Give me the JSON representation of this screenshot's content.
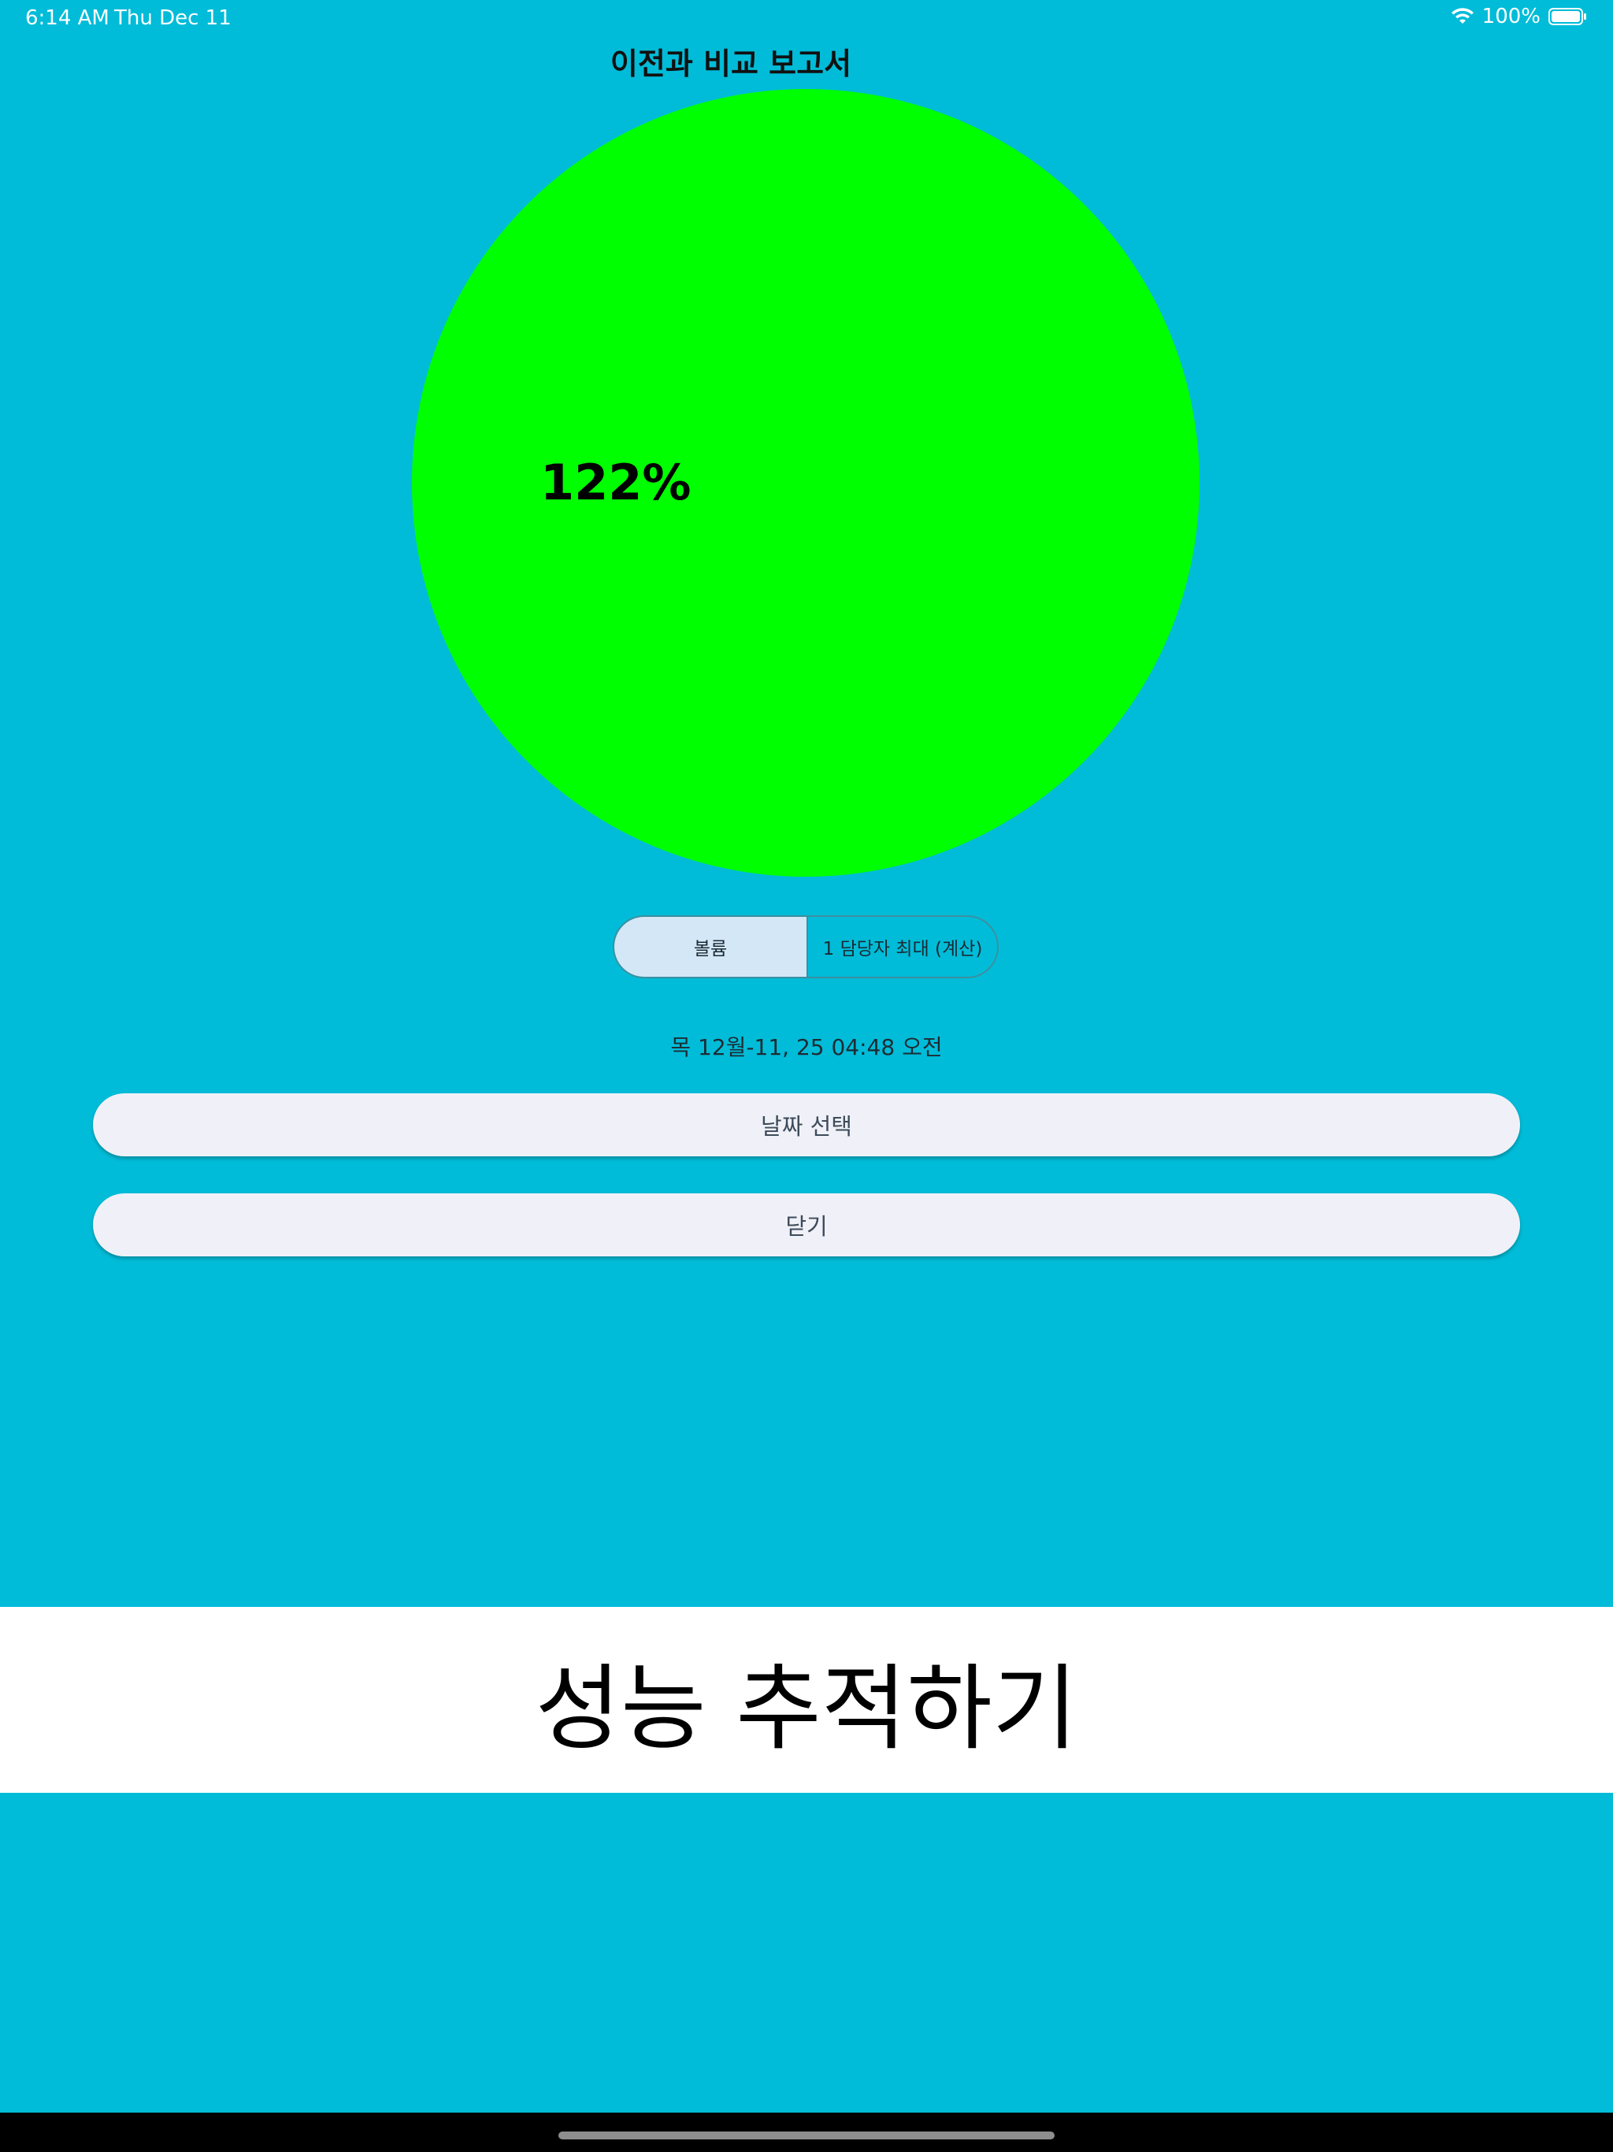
{
  "status_bar": {
    "time": "6:14 AM",
    "date": "Thu Dec 11",
    "battery": "100%"
  },
  "report": {
    "title": "이전과 비교 보고서"
  },
  "chart_data": {
    "type": "pie",
    "slices": [
      {
        "label": "122%",
        "value": 122,
        "color": "#00FF00"
      }
    ]
  },
  "segmented_control": {
    "selected": "볼륨",
    "options": [
      "볼륨",
      "1 담당자 최대 (계산)"
    ]
  },
  "timestamp": "목 12월-11, 25 04:48 오전",
  "buttons": {
    "select_date": "날짜 선택",
    "close": "닫기"
  },
  "banner": {
    "text": "성능 추적하기"
  },
  "colors": {
    "background": "#00BCD8",
    "pie": "#00FF00",
    "segment_selected": "#D4E7F7",
    "button_bg": "#F0F1F8"
  }
}
